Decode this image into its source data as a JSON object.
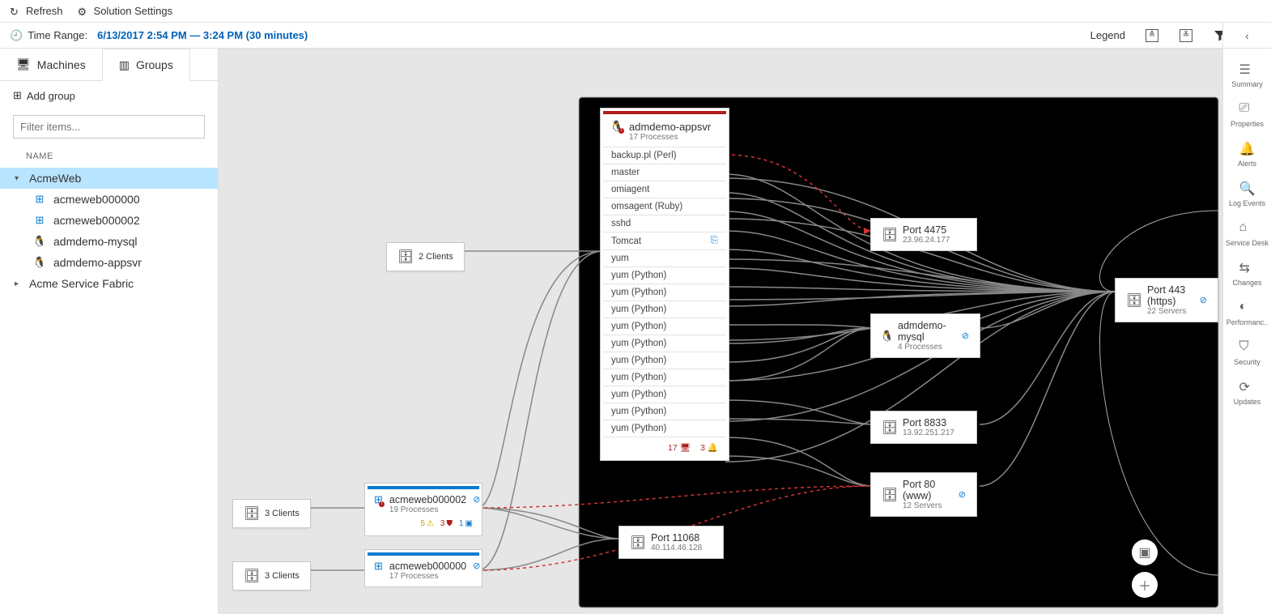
{
  "topbar": {
    "refresh": "Refresh",
    "settings": "Solution Settings"
  },
  "timebar": {
    "label": "Time Range:",
    "range": "6/13/2017 2:54 PM — 3:24 PM (30 minutes)",
    "legend": "Legend"
  },
  "tabs": {
    "machines": "Machines",
    "groups": "Groups"
  },
  "sidebar": {
    "addgroup": "Add group",
    "filter_placeholder": "Filter items...",
    "name_header": "NAME",
    "items": [
      {
        "label": "AcmeWeb",
        "expanded": true,
        "selected": true,
        "children": [
          {
            "label": "acmeweb000000",
            "os": "win"
          },
          {
            "label": "acmeweb000002",
            "os": "win"
          },
          {
            "label": "admdemo-mysql",
            "os": "linux"
          },
          {
            "label": "admdemo-appsvr",
            "os": "linux"
          }
        ]
      },
      {
        "label": "Acme Service Fabric",
        "expanded": false
      }
    ]
  },
  "clients": {
    "top3": "3 Clients",
    "bot3": "3 Clients",
    "two": "2 Clients"
  },
  "machines": {
    "m2": {
      "title": "acmeweb000002",
      "sub": "19 Processes",
      "b1": "5",
      "b2": "3",
      "b3": "1"
    },
    "m0": {
      "title": "acmeweb000000",
      "sub": "17 Processes"
    }
  },
  "appsvr": {
    "title": "admdemo-appsvr",
    "sub": "17 Processes",
    "procs": [
      "backup.pl (Perl)",
      "master",
      "omiagent",
      "omsagent (Ruby)",
      "sshd",
      "Tomcat",
      "yum",
      "yum (Python)",
      "yum (Python)",
      "yum (Python)",
      "yum (Python)",
      "yum (Python)",
      "yum (Python)",
      "yum (Python)",
      "yum (Python)",
      "yum (Python)",
      "yum (Python)"
    ],
    "ftr": {
      "n1": "17",
      "n2": "3"
    }
  },
  "ports": {
    "p4475": {
      "title": "Port 4475",
      "sub": "23.96.24.177"
    },
    "mysql": {
      "title": "admdemo-mysql",
      "sub": "4 Processes"
    },
    "p443": {
      "title": "Port 443 (https)",
      "sub": "22 Servers"
    },
    "p8833": {
      "title": "Port 8833",
      "sub": "13.92.251.217"
    },
    "p80": {
      "title": "Port 80 (www)",
      "sub": "12 Servers"
    },
    "p11068": {
      "title": "Port 11068",
      "sub": "40.114.46.128"
    }
  },
  "rail": {
    "summary": "Summary",
    "properties": "Properties",
    "alerts": "Alerts",
    "log": "Log Events",
    "service": "Service Desk",
    "changes": "Changes",
    "perf": "Performanc..",
    "security": "Security",
    "updates": "Updates"
  }
}
